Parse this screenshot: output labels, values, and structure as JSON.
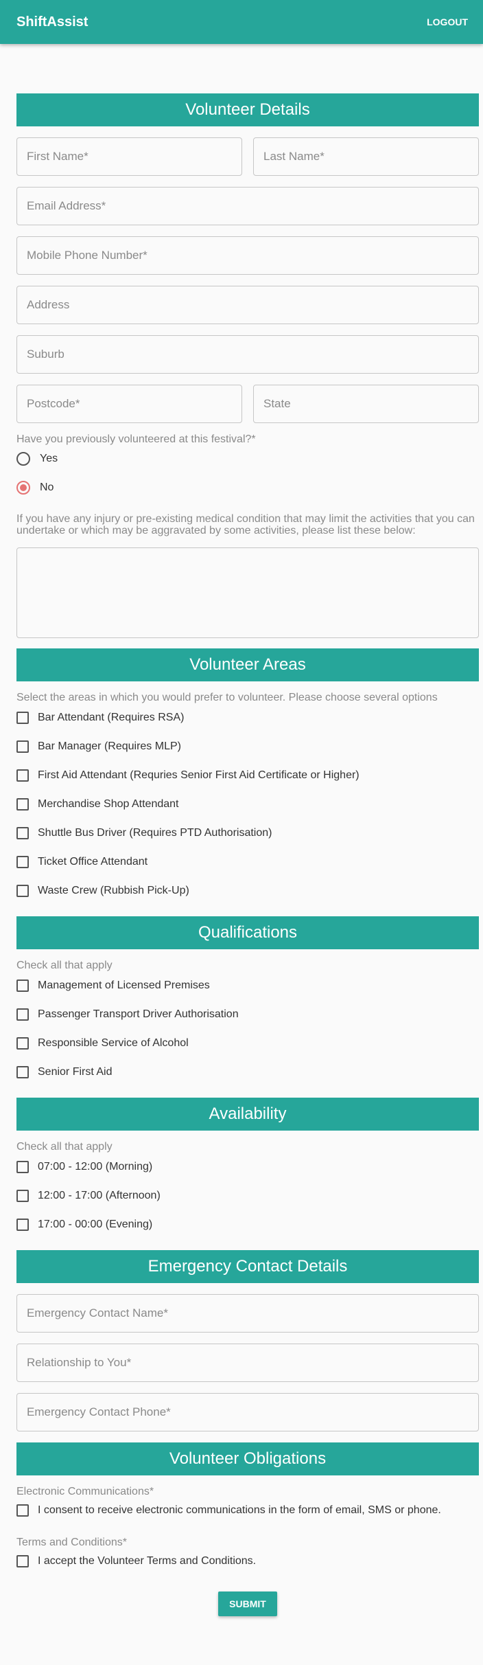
{
  "header": {
    "brand": "ShiftAssist",
    "logout": "LOGOUT"
  },
  "volunteer_details": {
    "title": "Volunteer Details",
    "first_name": "First Name*",
    "last_name": "Last Name*",
    "email": "Email Address*",
    "mobile": "Mobile Phone Number*",
    "address": "Address",
    "suburb": "Suburb",
    "postcode": "Postcode*",
    "state": "State",
    "previously_question": "Have you previously volunteered at this festival?*",
    "options": [
      {
        "label": "Yes",
        "checked": false
      },
      {
        "label": "No",
        "checked": true
      }
    ],
    "medical_prompt": "If you have any injury or pre-existing medical condition that may limit the activities that you can undertake or which may be aggravated by some activities, please list these below:",
    "medical_value": ""
  },
  "volunteer_areas": {
    "title": "Volunteer Areas",
    "hint": "Select the areas in which you would prefer to volunteer. Please choose several options",
    "items": [
      "Bar Attendant (Requires RSA)",
      "Bar Manager (Requires MLP)",
      "First Aid Attendant (Requries Senior First Aid Certificate or Higher)",
      "Merchandise Shop Attendant",
      "Shuttle Bus Driver (Requires PTD Authorisation)",
      "Ticket Office Attendant",
      "Waste Crew (Rubbish Pick-Up)"
    ]
  },
  "qualifications": {
    "title": "Qualifications",
    "hint": "Check all that apply",
    "items": [
      "Management of Licensed Premises",
      "Passenger Transport Driver Authorisation",
      "Responsible Service of Alcohol",
      "Senior First Aid"
    ]
  },
  "availability": {
    "title": "Availability",
    "hint": "Check all that apply",
    "items": [
      "07:00 - 12:00 (Morning)",
      "12:00 - 17:00 (Afternoon)",
      "17:00 - 00:00 (Evening)"
    ]
  },
  "emergency": {
    "title": "Emergency Contact Details",
    "name": "Emergency Contact Name*",
    "relationship": "Relationship to You*",
    "phone": "Emergency Contact Phone*"
  },
  "obligations": {
    "title": "Volunteer Obligations",
    "comms_label": "Electronic Communications*",
    "comms_consent": "I consent to receive electronic communications in the form of email, SMS or phone.",
    "terms_label": "Terms and Conditions*",
    "terms_accept": "I accept the Volunteer Terms and Conditions."
  },
  "submit": "SUBMIT",
  "colors": {
    "accent": "#26a69a",
    "radio_selected": "#e57373"
  }
}
